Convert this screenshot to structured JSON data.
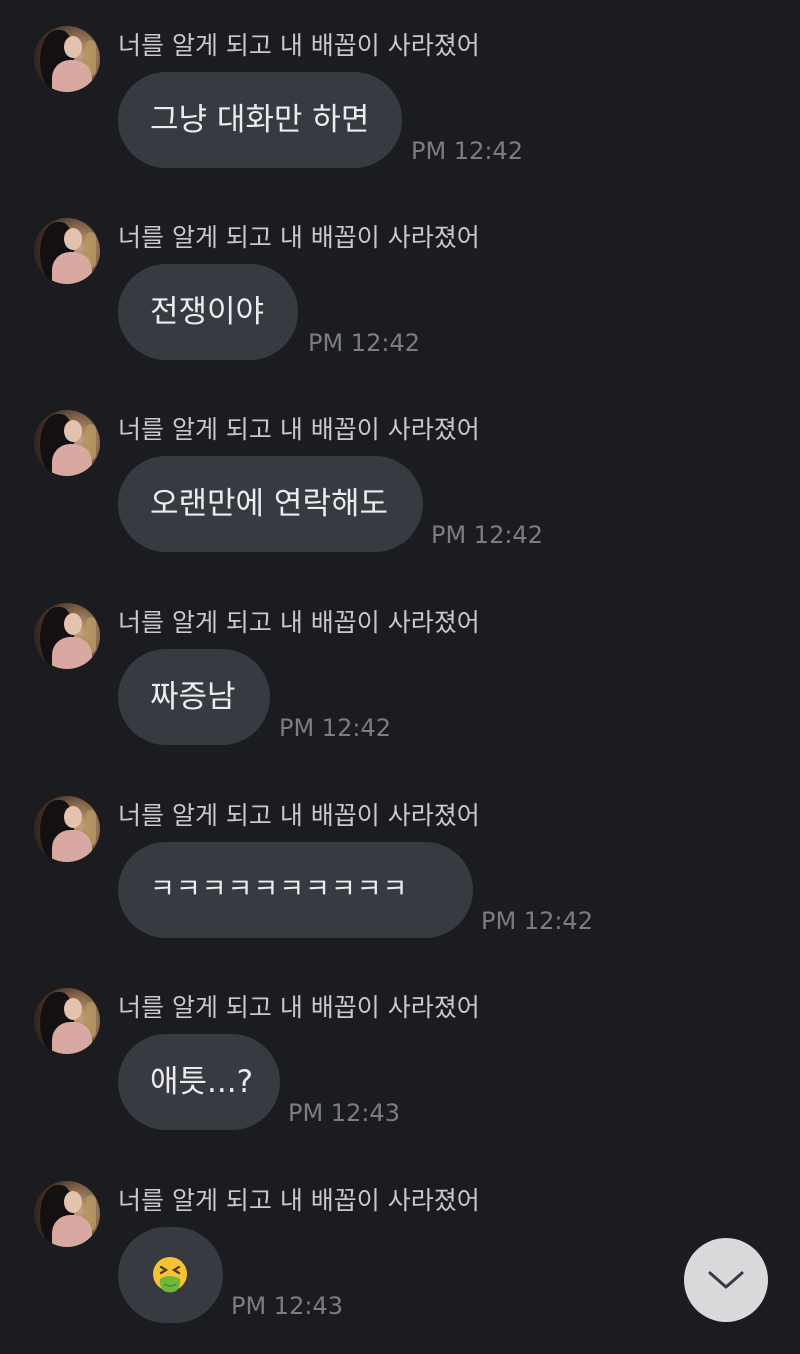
{
  "messages": [
    {
      "sender": "너를 알게 되고 내 배꼽이 사라졌어",
      "text": "그냥 대화만 하면",
      "time": "PM 12:42"
    },
    {
      "sender": "너를 알게 되고 내 배꼽이 사라졌어",
      "text": "전쟁이야",
      "time": "PM 12:42"
    },
    {
      "sender": "너를 알게 되고 내 배꼽이 사라졌어",
      "text": "오랜만에 연락해도",
      "time": "PM 12:42"
    },
    {
      "sender": "너를 알게 되고 내 배꼽이 사라졌어",
      "text": "짜증남",
      "time": "PM 12:42"
    },
    {
      "sender": "너를 알게 되고 내 배꼽이 사라졌어",
      "text": "ㅋㅋㅋㅋㅋㅋㅋㅋㅋㅋ",
      "time": "PM 12:42"
    },
    {
      "sender": "너를 알게 되고 내 배꼽이 사라졌어",
      "text": "애틋...?",
      "time": "PM 12:43"
    },
    {
      "sender": "너를 알게 되고 내 배꼽이 사라졌어",
      "text": "",
      "emoji": "vomiting-face",
      "time": "PM 12:43"
    }
  ],
  "scroll_button": {
    "icon": "chevron-down-icon"
  },
  "colors": {
    "background": "#1b1c20",
    "bubble": "#383a42",
    "text": "#ececef",
    "sender": "#c9c9cc",
    "time": "#7b7d83",
    "scroll_button": "#d9dadc"
  }
}
